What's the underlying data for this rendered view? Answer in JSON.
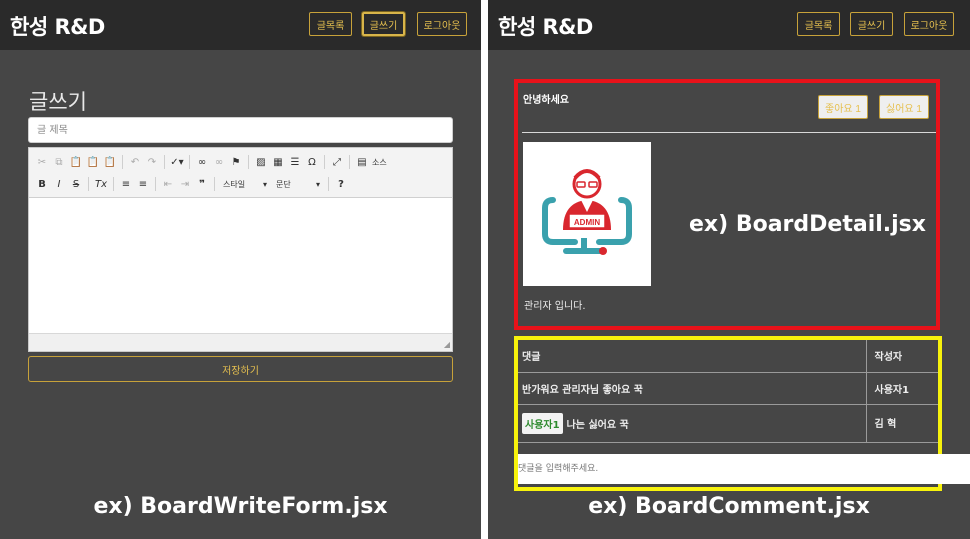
{
  "left": {
    "brand": "한성 R&D",
    "nav": {
      "list": "글목록",
      "write": "글쓰기",
      "logout": "로그아웃"
    },
    "page_title": "글쓰기",
    "title_placeholder": "글 제목",
    "toolbar": {
      "source_label": "소스",
      "style_label": "스타일",
      "format_label": "문단"
    },
    "save_label": "저장하기",
    "caption": "ex)  BoardWriteForm.jsx"
  },
  "right": {
    "brand": "한성 R&D",
    "nav": {
      "list": "글목록",
      "write": "글쓰기",
      "logout": "로그아웃"
    },
    "post": {
      "title": "안녕하세요",
      "like_label": "좋아요 1",
      "dislike_label": "싫어요 1",
      "image_text": "ADMIN",
      "content": "관리자 입니다."
    },
    "detail_label": "ex)  BoardDetail.jsx",
    "comments": {
      "header_comment": "댓글",
      "header_author": "작성자",
      "rows": [
        {
          "mention": "",
          "text": "반가워요 관리자님 좋아요 꾹",
          "author": "사용자1"
        },
        {
          "mention": "사용자1",
          "text": "나는 싫어요 꾹",
          "author": "김 혁"
        }
      ],
      "input_placeholder": "댓글을 입력해주세요."
    },
    "caption": "ex)  BoardComment.jsx"
  },
  "colors": {
    "accent": "#e6c04f",
    "red_box": "#e8121a",
    "yellow_box": "#f7f20c",
    "background": "#464646",
    "navbar": "#2a2a2a"
  }
}
